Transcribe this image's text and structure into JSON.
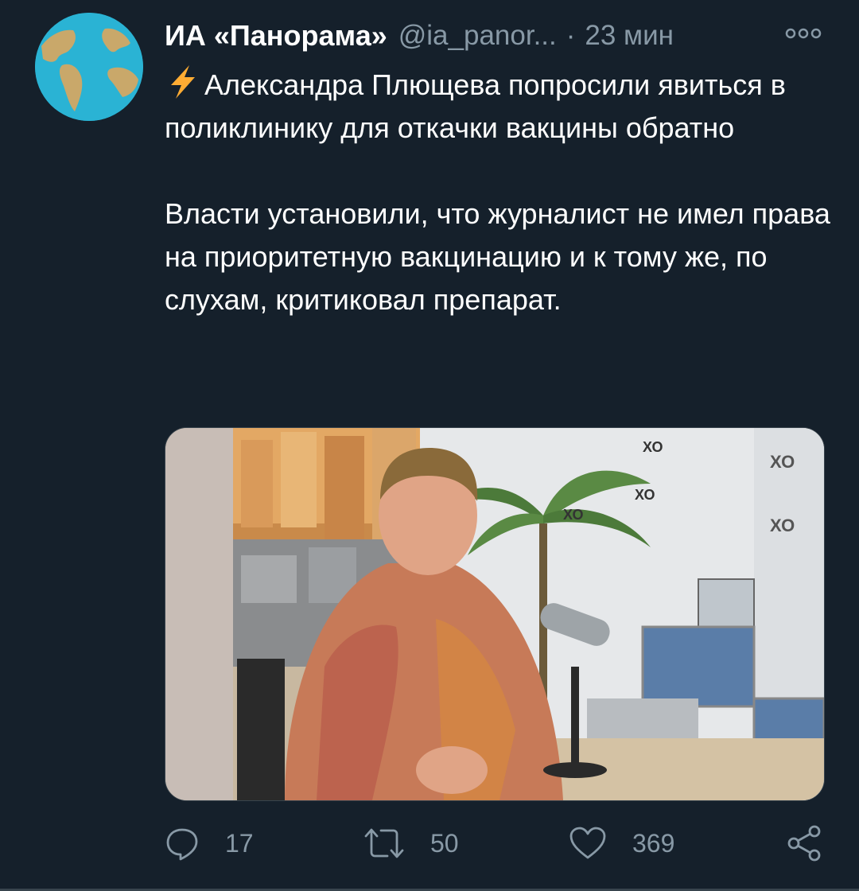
{
  "tweet": {
    "author": {
      "display_name": "ИА «Панорама»",
      "handle": "@ia_panor...",
      "avatar_icon": "globe-icon"
    },
    "separator": "·",
    "time": "23 мин",
    "more_icon": "more-options-icon",
    "text": {
      "lead_icon": "lightning-bolt-icon",
      "paragraph_1": "Александра Плющева попросили явиться в поликлинику для откачки вакцины обратно",
      "paragraph_2": "Власти установили, что журналист не имел права на приоритетную вакцинацию и к тому же, по слухам, критиковал препарат."
    },
    "media": {
      "type": "photo",
      "logo_text": "ХО"
    },
    "actions": {
      "reply": {
        "icon": "reply-icon",
        "count": "17"
      },
      "retweet": {
        "icon": "retweet-icon",
        "count": "50"
      },
      "like": {
        "icon": "heart-icon",
        "count": "369"
      },
      "share": {
        "icon": "share-icon"
      }
    }
  },
  "colors": {
    "background": "#15202b",
    "text_primary": "#ffffff",
    "text_secondary": "#8899a6",
    "border": "#38444d",
    "bolt": "#ffac33"
  }
}
